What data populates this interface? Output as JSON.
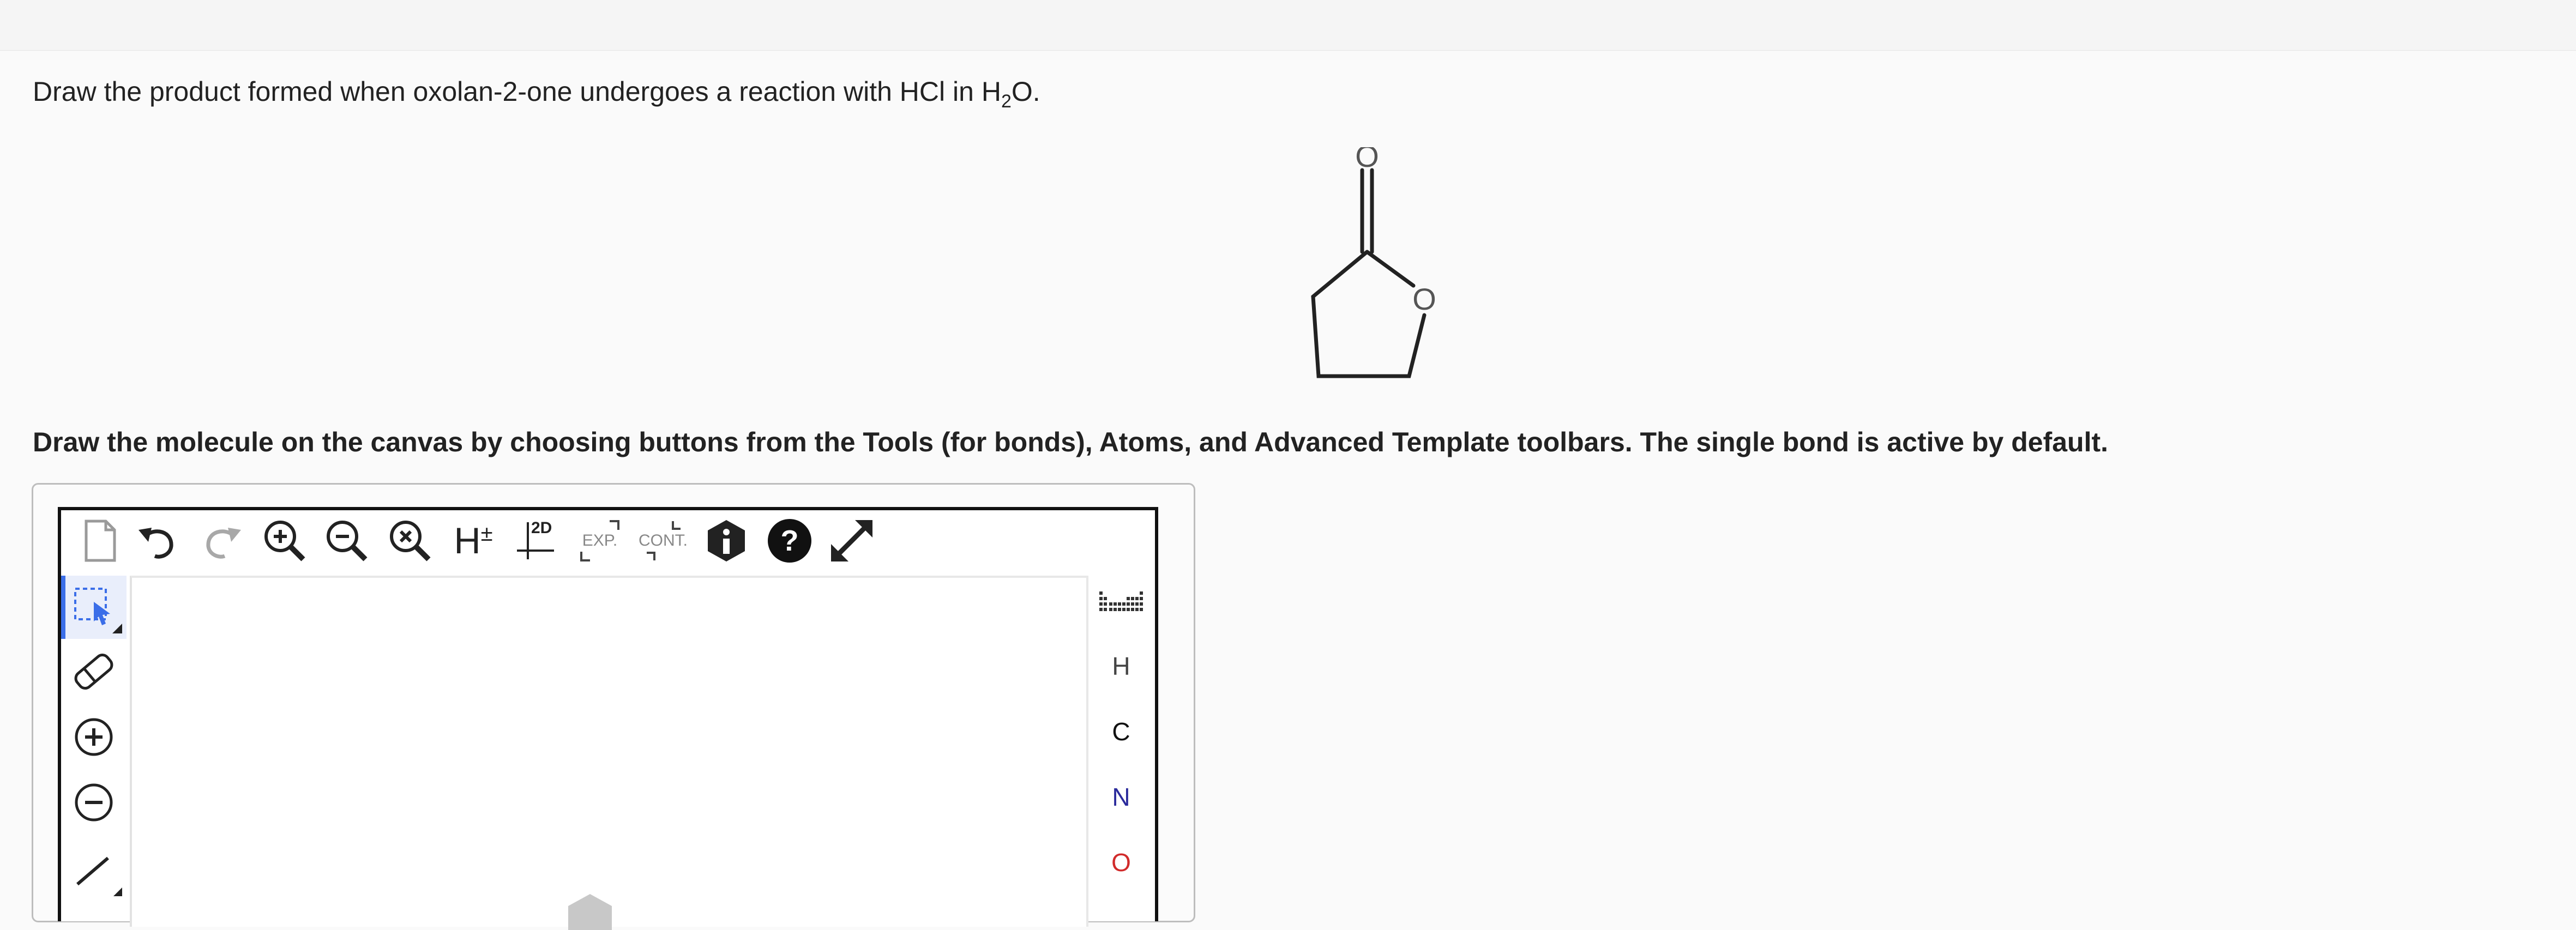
{
  "question": {
    "prefix": "Draw the product formed when oxolan-2-one undergoes a reaction with HCl in H",
    "subscript": "2",
    "suffix": "O."
  },
  "molecule": {
    "carbonyl_oxygen": "O",
    "ring_oxygen": "O"
  },
  "instructions": "Draw the molecule on the canvas by choosing buttons from the Tools (for bonds), Atoms, and Advanced Template toolbars. The single bond is active by default.",
  "toolbar": {
    "h_toggle_label": "H",
    "h_toggle_sign": "±",
    "layout_label": "2D",
    "expand_label": "EXP.",
    "contract_label": "CONT."
  },
  "atoms": {
    "hydrogen": "H",
    "carbon": "C",
    "nitrogen": "N",
    "oxygen": "O"
  },
  "colors": {
    "nitrogen": "#2b2b9c",
    "oxygen": "#d12b2b",
    "active_tool": "#3b6ee8"
  }
}
